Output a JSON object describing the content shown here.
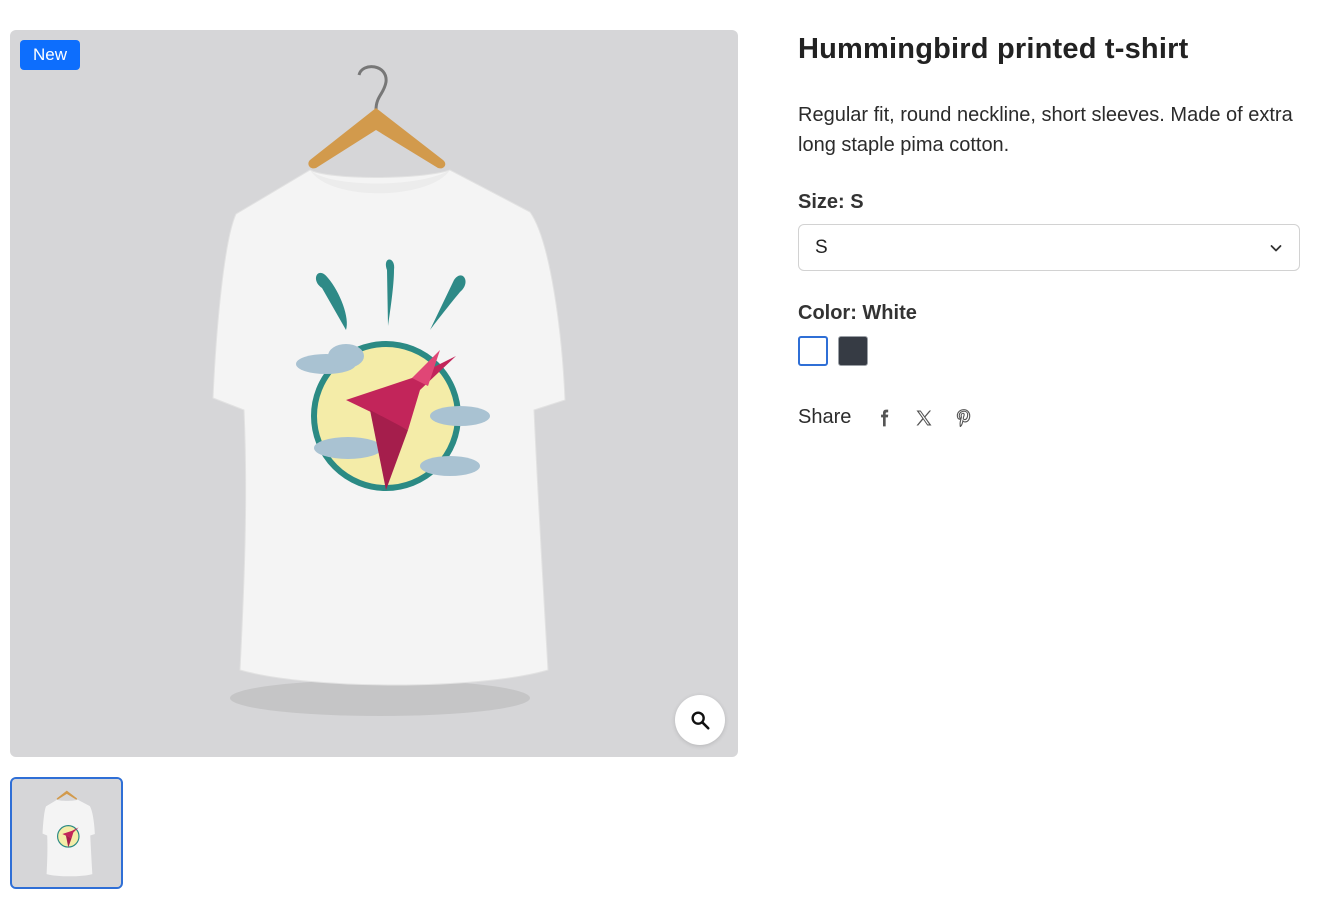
{
  "product": {
    "badge": "New",
    "title": "Hummingbird printed t-shirt",
    "description": "Regular fit, round neckline, short sleeves. Made of extra long staple pima cotton."
  },
  "size": {
    "label": "Size: S",
    "selected": "S"
  },
  "color": {
    "label": "Color: White",
    "options": [
      {
        "name": "White",
        "hex": "#ffffff",
        "selected": true
      },
      {
        "name": "Dark grey",
        "hex": "#363b44",
        "selected": false
      }
    ]
  },
  "share": {
    "label": "Share",
    "icons": [
      "facebook-icon",
      "x-icon",
      "pinterest-icon"
    ]
  },
  "gallery": {
    "zoom_icon": "search-icon",
    "thumbnails": 1
  },
  "colors": {
    "accent": "#0d6efd",
    "image_bg": "#d6d6d8"
  }
}
